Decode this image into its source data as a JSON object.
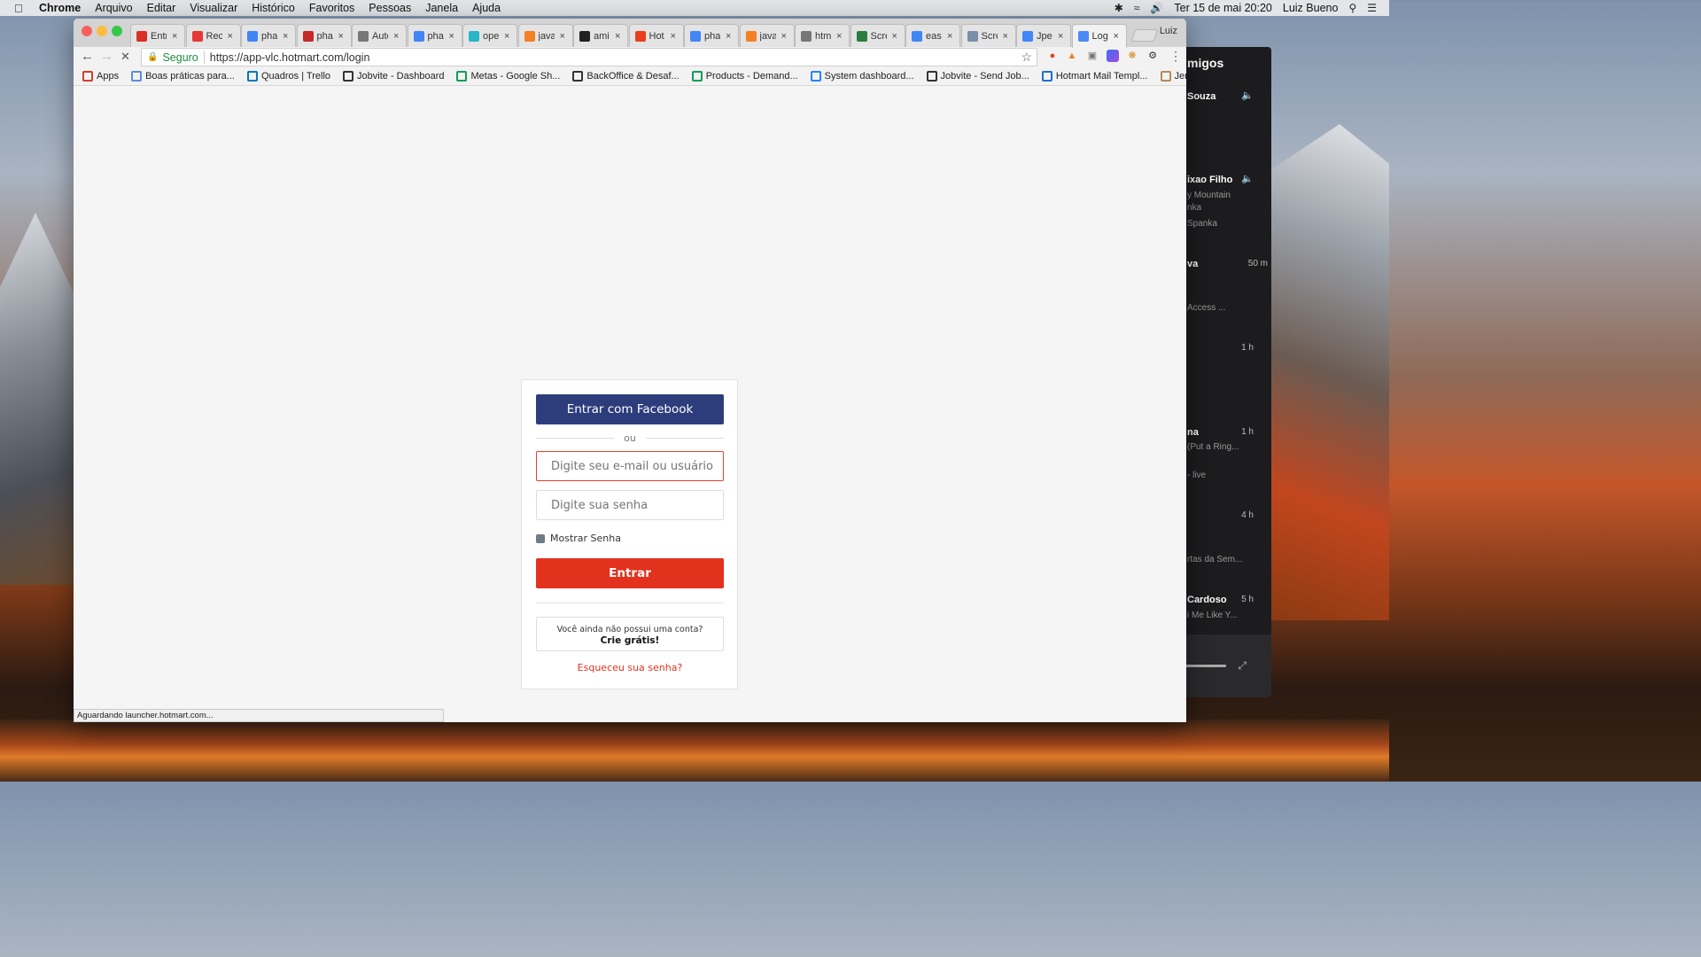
{
  "menubar": {
    "app_name": "Chrome",
    "items": [
      "Arquivo",
      "Editar",
      "Visualizar",
      "Histórico",
      "Favoritos",
      "Pessoas",
      "Janela",
      "Ajuda"
    ],
    "datetime": "Ter 15 de mai  20:20",
    "user": "Luiz Bueno"
  },
  "tabs": [
    {
      "label": "Entr",
      "icon": "gmail-icon",
      "color": "#d93025"
    },
    {
      "label": "Rec",
      "icon": "recruit-icon",
      "color": "#e53935"
    },
    {
      "label": "pha",
      "icon": "google-icon",
      "color": "#4285f4"
    },
    {
      "label": "pha",
      "icon": "phabricator-icon",
      "color": "#c62828"
    },
    {
      "label": "Auto",
      "icon": "doc-icon",
      "color": "#777777"
    },
    {
      "label": "pha",
      "icon": "google-icon",
      "color": "#4285f4"
    },
    {
      "label": "ope",
      "icon": "openapi-icon",
      "color": "#29b6c8"
    },
    {
      "label": "java",
      "icon": "stackoverflow-icon",
      "color": "#f48024"
    },
    {
      "label": "ami",
      "icon": "github-icon",
      "color": "#222222"
    },
    {
      "label": "Hot",
      "icon": "hotmart-icon",
      "color": "#e8401c"
    },
    {
      "label": "pha",
      "icon": "google-icon",
      "color": "#4285f4"
    },
    {
      "label": "java",
      "icon": "stackoverflow-icon",
      "color": "#f48024"
    },
    {
      "label": "htm",
      "icon": "doc-icon",
      "color": "#777777"
    },
    {
      "label": "Scre",
      "icon": "w3schools-icon",
      "color": "#2a7d3e"
    },
    {
      "label": "easy",
      "icon": "google-icon",
      "color": "#4285f4"
    },
    {
      "label": "Scre",
      "icon": "puzzle-icon",
      "color": "#7a8ea8"
    },
    {
      "label": "Jpe",
      "icon": "google-icon",
      "color": "#4285f4"
    },
    {
      "label": "Logi",
      "icon": "loading-icon",
      "color": "#4a8af4",
      "active": true
    }
  ],
  "profile_name": "Luiz",
  "omnibox": {
    "secure_label": "Seguro",
    "url": "https://app-vlc.hotmart.com/login"
  },
  "bookmarks": [
    {
      "label": "Apps",
      "icon": "apps-grid-icon"
    },
    {
      "label": "Boas práticas para...",
      "icon": "loading-icon"
    },
    {
      "label": "Quadros | Trello",
      "icon": "trello-icon"
    },
    {
      "label": "Jobvite - Dashboard",
      "icon": "jobvite-icon"
    },
    {
      "label": "Metas - Google Sh...",
      "icon": "sheets-icon"
    },
    {
      "label": "BackOffice & Desaf...",
      "icon": "board-icon"
    },
    {
      "label": "Products - Demand...",
      "icon": "sheets-icon"
    },
    {
      "label": "System dashboard...",
      "icon": "jira-icon"
    },
    {
      "label": "Jobvite - Send Job...",
      "icon": "jobvite-icon"
    },
    {
      "label": "Hotmart Mail Templ...",
      "icon": "tx-icon"
    },
    {
      "label": "Jenkins",
      "icon": "jenkins-icon"
    }
  ],
  "login": {
    "facebook_button": "Entrar com Facebook",
    "separator": "ou",
    "email_placeholder": "Digite seu e-mail ou usuário",
    "password_placeholder": "Digite sua senha",
    "show_password_label": "Mostrar Senha",
    "enter_button": "Entrar",
    "signup_question": "Você ainda não possui uma conta?",
    "signup_cta": "Crie grátis!",
    "forgot_link": "Esqueceu sua senha?"
  },
  "status_text": "Aguardando launcher.hotmart.com...",
  "side_app": {
    "title": "migos",
    "entries": [
      {
        "name": "Souza",
        "detail": "",
        "time": ""
      },
      {
        "name": "ixao Filho",
        "detail": "y Mountain",
        "detail2": "nka",
        "detail3": "Spanka",
        "time": ""
      },
      {
        "name": "va",
        "detail": "Access ...",
        "time": "50 m"
      },
      {
        "name": "",
        "detail": "",
        "time": "1 h"
      },
      {
        "name": "na",
        "detail": "(Put a Ring...",
        "detail2": "- live",
        "time": "1 h"
      },
      {
        "name": "",
        "detail": "rtas da Sem...",
        "time": "4 h"
      },
      {
        "name": "Cardoso",
        "detail": "i Me Like Y...",
        "time": "5 h"
      }
    ]
  },
  "colors": {
    "facebook_blue": "#2d3d7c",
    "hotmart_red": "#e2321e",
    "secure_green": "#1e8e3e"
  }
}
